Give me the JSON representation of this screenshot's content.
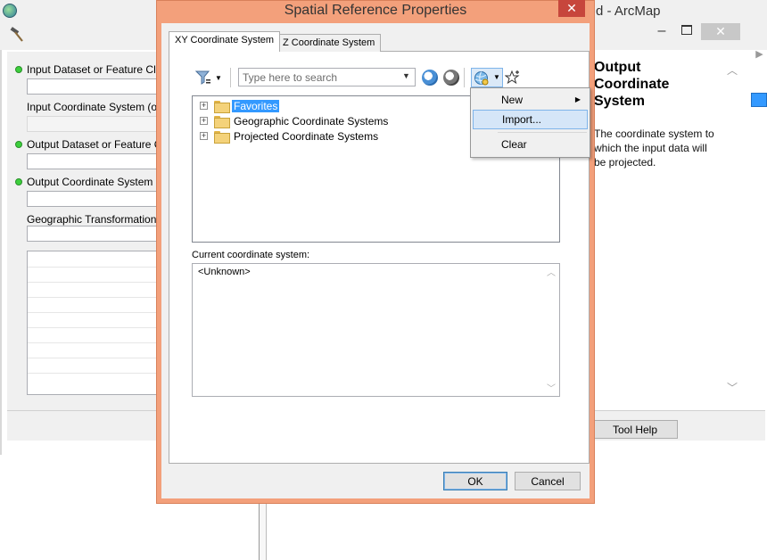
{
  "background_window": {
    "title": "d - ArcMap",
    "close_glyph": "✕",
    "minimize_glyph": "–",
    "form": {
      "fields": [
        {
          "label": "Input Dataset or Feature Class",
          "required": true
        },
        {
          "label": "Input Coordinate System (optior",
          "required": false
        },
        {
          "label": "Output Dataset or Feature Clas",
          "required": true
        },
        {
          "label": "Output Coordinate System",
          "required": true
        },
        {
          "label": "Geographic Transformation (op",
          "required": false
        }
      ]
    },
    "help_panel": {
      "title": "Output Coordinate System",
      "text": "The coordinate system to which the input data will be projected."
    },
    "tool_help_label": "Tool Help"
  },
  "dialog": {
    "title": "Spatial Reference Properties",
    "close_glyph": "✕",
    "tabs": [
      {
        "label": "XY Coordinate System",
        "active": true
      },
      {
        "label": "Z Coordinate System",
        "active": false
      }
    ],
    "search": {
      "placeholder": "Type here to search",
      "value": ""
    },
    "tree": [
      {
        "label": "Favorites",
        "selected": true,
        "icon": "favorites-folder-icon"
      },
      {
        "label": "Geographic Coordinate Systems",
        "selected": false,
        "icon": "folder-icon"
      },
      {
        "label": "Projected Coordinate Systems",
        "selected": false,
        "icon": "folder-icon"
      }
    ],
    "current_label": "Current coordinate system:",
    "current_value": "<Unknown>",
    "ok_label": "OK",
    "cancel_label": "Cancel"
  },
  "menu": {
    "items": [
      {
        "label": "New",
        "has_submenu": true
      },
      {
        "label": "Import...",
        "hover": true
      },
      {
        "label": "Clear"
      }
    ]
  },
  "colors": {
    "dialog_frame": "#f3a07b",
    "selection": "#3399ff",
    "menu_hover": "#d5e6f8",
    "required_dot": "#3ccf3c"
  }
}
